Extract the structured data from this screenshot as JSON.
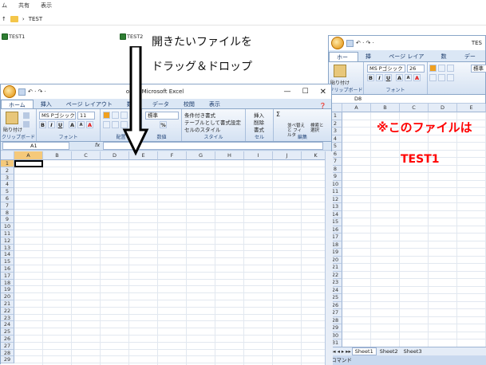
{
  "explorer": {
    "menu": [
      "ム",
      "共有",
      "表示"
    ],
    "path": "TEST",
    "files": [
      "TEST1",
      "TEST2"
    ]
  },
  "instruction": {
    "line1": "開きたいファイルを",
    "line2": "ドラッグ＆ドロップ"
  },
  "left": {
    "title": "ok1 - Microsoft Excel",
    "qa_arrows": "↶ · ↷ ·",
    "tabs": [
      "ホーム",
      "挿入",
      "ページ レイアウト",
      "数式",
      "データ",
      "校閲",
      "表示"
    ],
    "active_tab": "ホーム",
    "ribbon": {
      "paste": "貼り付け",
      "clipboard": "クリップボード",
      "font_name": "MS Pゴシック",
      "font_size": "11",
      "font": "フォント",
      "number_format": "標準",
      "align": "配置",
      "number": "数値",
      "cond": "条件付き書式",
      "table": "テーブルとして書式設定",
      "cellstyle": "セルのスタイル",
      "style": "スタイル",
      "insert": "挿入",
      "delete": "削除",
      "format": "書式",
      "cells": "セル",
      "sort": "並べ替えと フィルタ",
      "find": "検索と 選択",
      "edit": "編集",
      "bold": "B",
      "italic": "I",
      "underline": "U",
      "grow": "A",
      "shrink": "A",
      "font_color": "A",
      "percent": "%",
      "sigma": "Σ"
    },
    "namebox": "A1",
    "fx": "fx",
    "columns": [
      "A",
      "B",
      "C",
      "D",
      "E",
      "F",
      "G",
      "H",
      "I",
      "J",
      "K"
    ],
    "rows": [
      "1",
      "2",
      "3",
      "4",
      "5",
      "6",
      "7",
      "8",
      "9",
      "10",
      "11",
      "12",
      "13",
      "14",
      "15",
      "16",
      "17",
      "18",
      "19",
      "20",
      "21",
      "22",
      "23",
      "24",
      "25",
      "26",
      "27",
      "28",
      "29"
    ]
  },
  "right": {
    "title": "TES",
    "qa_arrows": "↶ · ↷ ·",
    "tabs": [
      "ホーム",
      "挿入",
      "ページ レイアウト",
      "数式",
      "データ"
    ],
    "active_tab": "ホーム",
    "ribbon": {
      "paste": "貼り付け",
      "clipboard": "クリップボード",
      "font_name": "MS Pゴシック",
      "font_size": "26",
      "font": "フォント",
      "number_format": "標準",
      "bold": "B",
      "italic": "I",
      "underline": "U",
      "grow": "A",
      "shrink": "A",
      "font_color": "A"
    },
    "namebox": "D8",
    "columns": [
      "A",
      "B",
      "C",
      "D",
      "E"
    ],
    "rows": [
      "1",
      "2",
      "3",
      "4",
      "5",
      "6",
      "7",
      "8",
      "9",
      "10",
      "11",
      "12",
      "13",
      "14",
      "15",
      "16",
      "17",
      "18",
      "19",
      "20",
      "21",
      "22",
      "23",
      "24",
      "25",
      "26",
      "27",
      "28",
      "29",
      "30",
      "31"
    ],
    "text1": "※このファイルは",
    "text2": "TEST1",
    "sheets": [
      "Sheet1",
      "Sheet2",
      "Sheet3"
    ],
    "status": "コマンド"
  },
  "colors": {
    "red_text": "#ff0000",
    "ribbon_blue": "#dbe7f5"
  }
}
